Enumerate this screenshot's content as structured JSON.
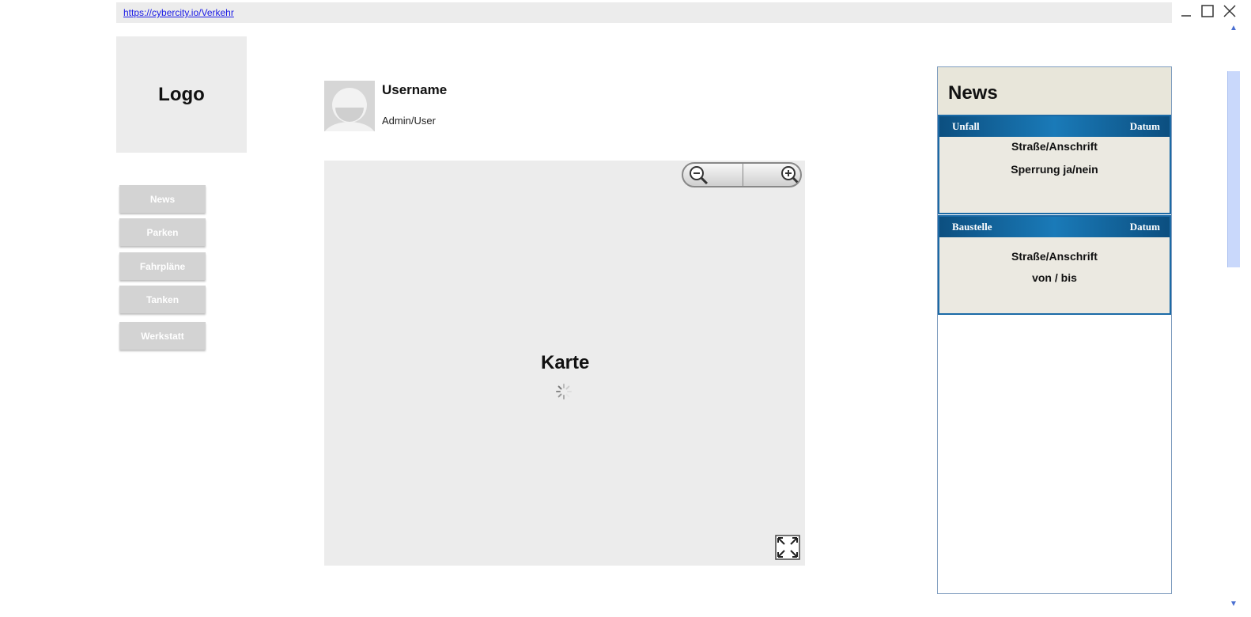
{
  "browser": {
    "url": "https://cybercity.io/Verkehr"
  },
  "logo": {
    "label": "Logo"
  },
  "nav": {
    "items": [
      {
        "label": "News"
      },
      {
        "label": "Parken"
      },
      {
        "label": "Fahrpläne"
      },
      {
        "label": "Tanken"
      },
      {
        "label": "Werkstatt"
      }
    ]
  },
  "user": {
    "name": "Username",
    "role": "Admin/User"
  },
  "map": {
    "title": "Karte"
  },
  "news": {
    "title": "News",
    "cards": [
      {
        "type": "Unfall",
        "date": "Datum",
        "line1": "Straße/Anschrift",
        "line2": "Sperrung ja/nein"
      },
      {
        "type": "Baustelle",
        "date": "Datum",
        "line1": "Straße/Anschrift",
        "line2": "von / bis"
      }
    ]
  },
  "colors": {
    "card_header": "#1a7ab8",
    "card_border": "#1b6aa6",
    "news_head_bg": "#e8e6da",
    "link": "#1a1ae6"
  }
}
